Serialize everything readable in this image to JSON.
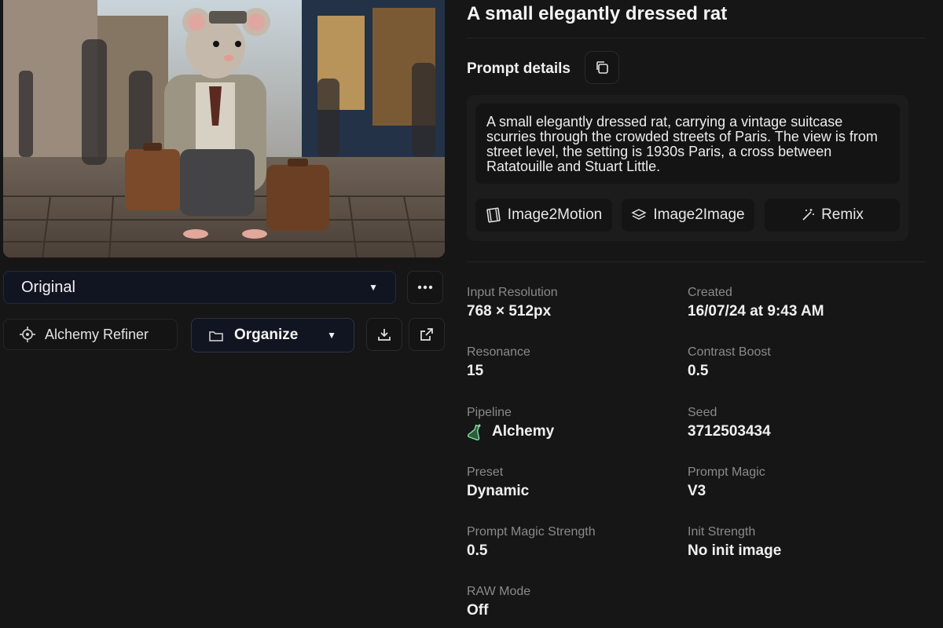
{
  "image": {
    "alt_icon": "generated-image"
  },
  "left": {
    "variant_select": {
      "value": "Original",
      "caret": "▼"
    },
    "more_icon": "more-horizontal-icon",
    "refiner_label": "Alchemy Refiner",
    "organize_label": "Organize",
    "organize_caret": "▼"
  },
  "right": {
    "title": "A small elegantly dressed rat",
    "prompt_details_label": "Prompt details",
    "prompt_text": "A small elegantly dressed rat, carrying a vintage suitcase scurries through the crowded streets of Paris. The view is from street level, the setting is 1930s Paris, a cross between Ratatouille and Stuart Little.",
    "actions": [
      {
        "label": "Image2Motion",
        "icon": "film-icon"
      },
      {
        "label": "Image2Image",
        "icon": "layers-icon"
      },
      {
        "label": "Remix",
        "icon": "magic-wand-icon"
      }
    ],
    "details": {
      "input_resolution": {
        "label": "Input Resolution",
        "value": "768 × 512px"
      },
      "created": {
        "label": "Created",
        "value": "16/07/24 at 9:43 AM"
      },
      "resonance": {
        "label": "Resonance",
        "value": "15"
      },
      "contrast_boost": {
        "label": "Contrast Boost",
        "value": "0.5"
      },
      "pipeline": {
        "label": "Pipeline",
        "value": "Alchemy"
      },
      "seed": {
        "label": "Seed",
        "value": "3712503434"
      },
      "preset": {
        "label": "Preset",
        "value": "Dynamic"
      },
      "prompt_magic": {
        "label": "Prompt Magic",
        "value": "V3"
      },
      "prompt_magic_strength": {
        "label": "Prompt Magic Strength",
        "value": "0.5"
      },
      "init_strength": {
        "label": "Init Strength",
        "value": "No init image"
      },
      "raw_mode": {
        "label": "RAW Mode",
        "value": "Off"
      }
    }
  },
  "colors": {
    "background": "#161616",
    "card": "#1c1c1c",
    "button_dark": "#141414",
    "select_navy": "#111521",
    "muted_text": "#8a8a8a",
    "pipeline_icon": "#7fe0a0"
  }
}
